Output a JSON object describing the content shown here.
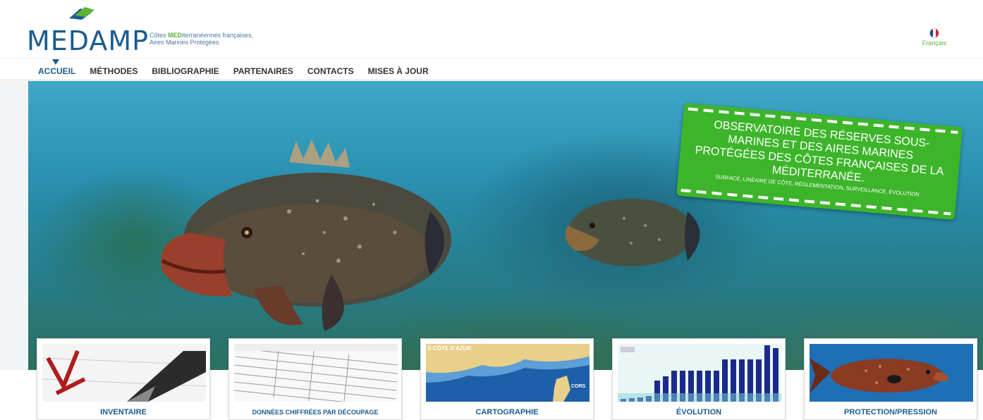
{
  "brand": {
    "name": "MEDAMP",
    "tagline_line1_prefix": "Côtes ",
    "tagline_line1_highlight": "MED",
    "tagline_line1_suffix": "iterranéennes françaises,",
    "tagline_line2": "Aires Marines Protégées"
  },
  "language": {
    "label": "Français"
  },
  "nav": {
    "items": [
      {
        "label": "ACCUEIL",
        "active": true
      },
      {
        "label": "MÉTHODES",
        "active": false
      },
      {
        "label": "BIBLIOGRAPHIE",
        "active": false
      },
      {
        "label": "PARTENAIRES",
        "active": false
      },
      {
        "label": "CONTACTS",
        "active": false
      },
      {
        "label": "MISES À JOUR",
        "active": false
      }
    ]
  },
  "hero": {
    "banner_title": "OBSERVATOIRE DES RÉSERVES SOUS-MARINES ET DES AIRES MARINES PROTÉGÉES DES CÔTES FRANÇAISES DE LA MÉDITERRANÉE.",
    "banner_subtitle": "SURFACE, LINÉAIRE DE CÔTE, RÉGLEMENTATION, SURVEILLANCE, ÉVOLUTION"
  },
  "cards": [
    {
      "label": "INVENTAIRE",
      "icon": "checklist-pen-image"
    },
    {
      "label": "DONNÉES CHIFFRÉES PAR DÉCOUPAGE",
      "icon": "data-table-image"
    },
    {
      "label": "CARTOGRAPHIE",
      "icon": "coast-map-image",
      "map_text_1": "S-CÔTE D'AZUR",
      "map_text_2": "CORS"
    },
    {
      "label": "ÉVOLUTION",
      "icon": "bar-chart-image"
    },
    {
      "label": "PROTECTION/PRESSION",
      "icon": "grouper-fish-image"
    }
  ],
  "colors": {
    "brand_blue": "#1a5c8f",
    "accent_green": "#5ab435",
    "banner_green": "#3db52a"
  }
}
